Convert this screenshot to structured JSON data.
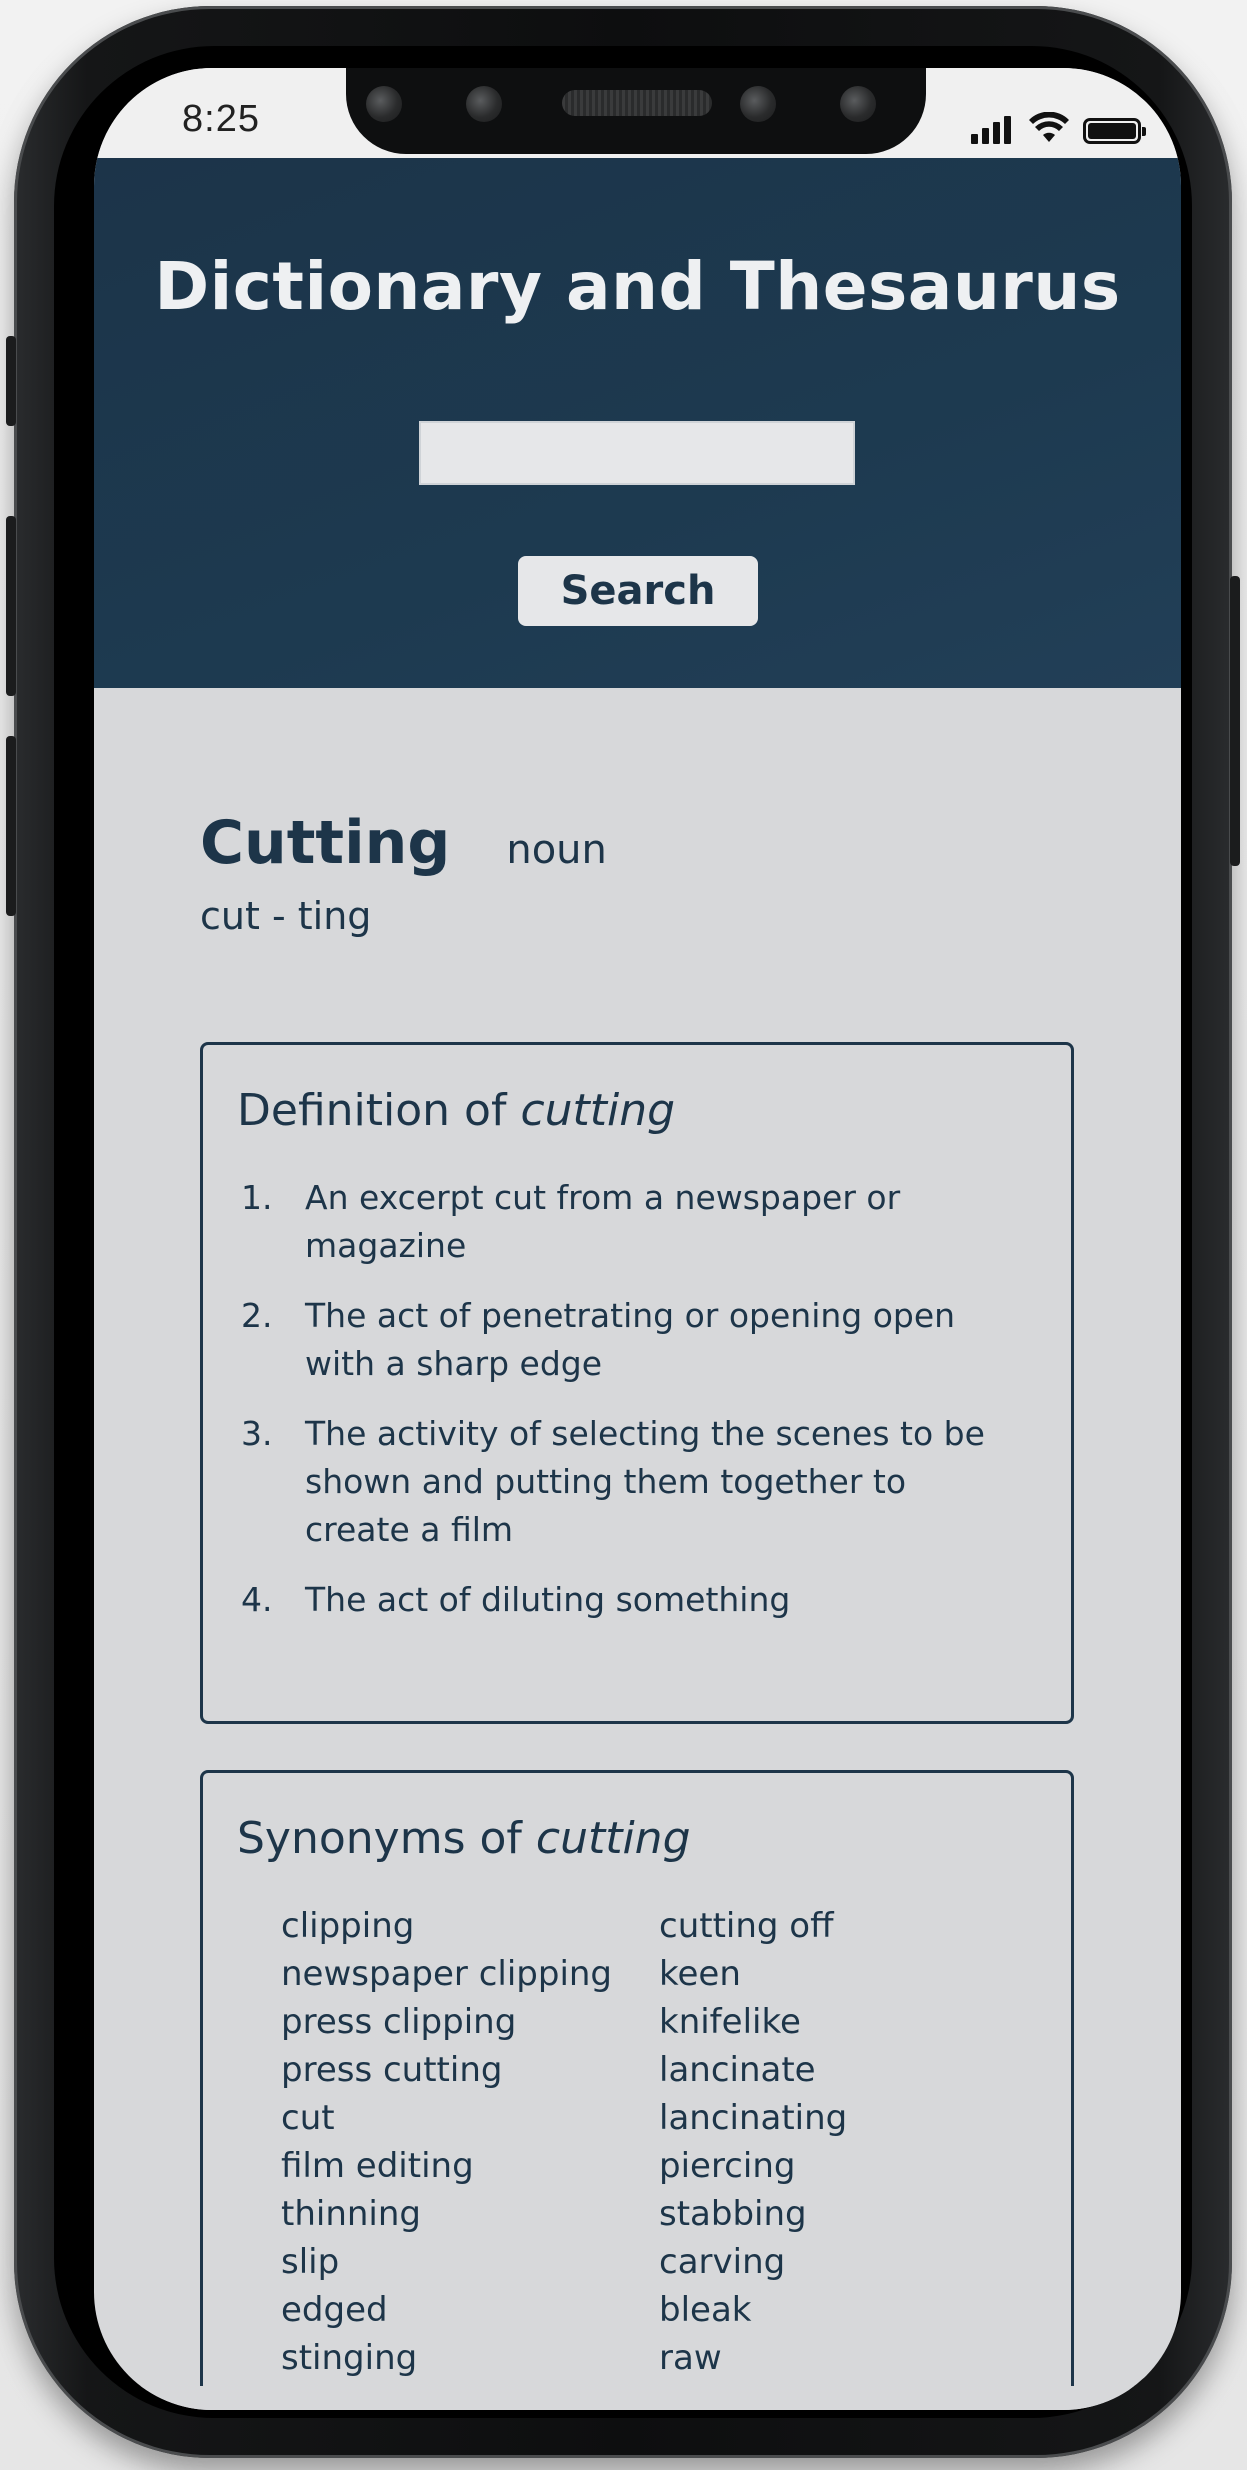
{
  "status_bar": {
    "time": "8:25"
  },
  "header": {
    "title": "Dictionary and Thesaurus",
    "search_value": "",
    "search_placeholder": "",
    "search_button": "Search",
    "background_color": "#1d3a50"
  },
  "entry": {
    "word": "Cutting",
    "part_of_speech": "noun",
    "syllables": "cut - ting"
  },
  "definitions": {
    "title_prefix": "Definition of ",
    "title_word": "cutting",
    "items": [
      {
        "num": "1.",
        "text": "An excerpt cut from a newspaper or magazine"
      },
      {
        "num": "2.",
        "text": "The act of penetrating or opening open with a sharp edge"
      },
      {
        "num": "3.",
        "text": "The activity of selecting the scenes to be shown and putting them together to create a film"
      },
      {
        "num": "4.",
        "text": "The act of diluting something"
      }
    ]
  },
  "synonyms": {
    "title_prefix": "Synonyms of ",
    "title_word": "cutting",
    "left": [
      "clipping",
      "newspaper clipping",
      "press clipping",
      "press cutting",
      "cut",
      "film editing",
      "thinning",
      "slip",
      "edged",
      "stinging"
    ],
    "right": [
      "cutting off",
      "keen",
      "knifelike",
      "lancinate",
      "lancinating",
      "piercing",
      "stabbing",
      "carving",
      "bleak",
      "raw"
    ]
  },
  "colors": {
    "text_primary": "#1d3549",
    "content_background": "#d7d8da",
    "header_background": "#1d3a50"
  }
}
